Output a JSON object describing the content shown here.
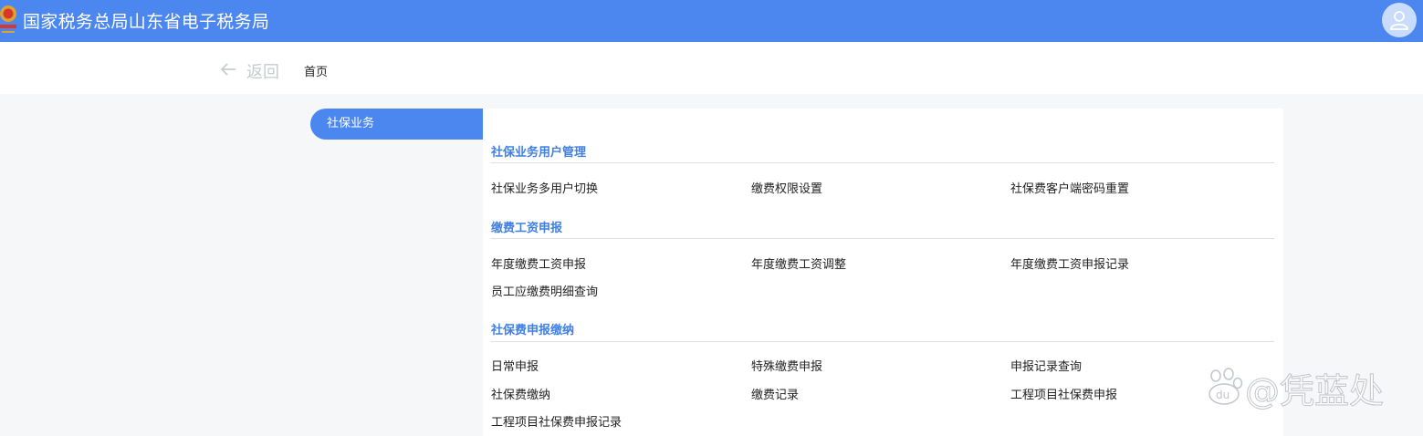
{
  "header": {
    "title": "国家税务总局山东省电子税务局",
    "logo_icon": "tax-emblem-icon",
    "avatar_icon": "user-icon",
    "brand_color": "#4b87ef"
  },
  "nav": {
    "back_label": "返回",
    "back_icon": "arrow-left-icon",
    "home_label": "首页"
  },
  "sidebar": {
    "active_tab": "社保业务"
  },
  "sections": [
    {
      "title": "社保业务用户管理",
      "items": [
        "社保业务多用户切换",
        "缴费权限设置",
        "社保费客户端密码重置"
      ]
    },
    {
      "title": "缴费工资申报",
      "items": [
        "年度缴费工资申报",
        "年度缴费工资调整",
        "年度缴费工资申报记录",
        "员工应缴费明细查询"
      ]
    },
    {
      "title": "社保费申报缴纳",
      "items": [
        "日常申报",
        "特殊缴费申报",
        "申报记录查询",
        "社保费缴纳",
        "缴费记录",
        "工程项目社保费申报",
        "工程项目社保费申报记录"
      ]
    }
  ],
  "watermark": {
    "badge": "du",
    "text": "@凭蓝处"
  }
}
